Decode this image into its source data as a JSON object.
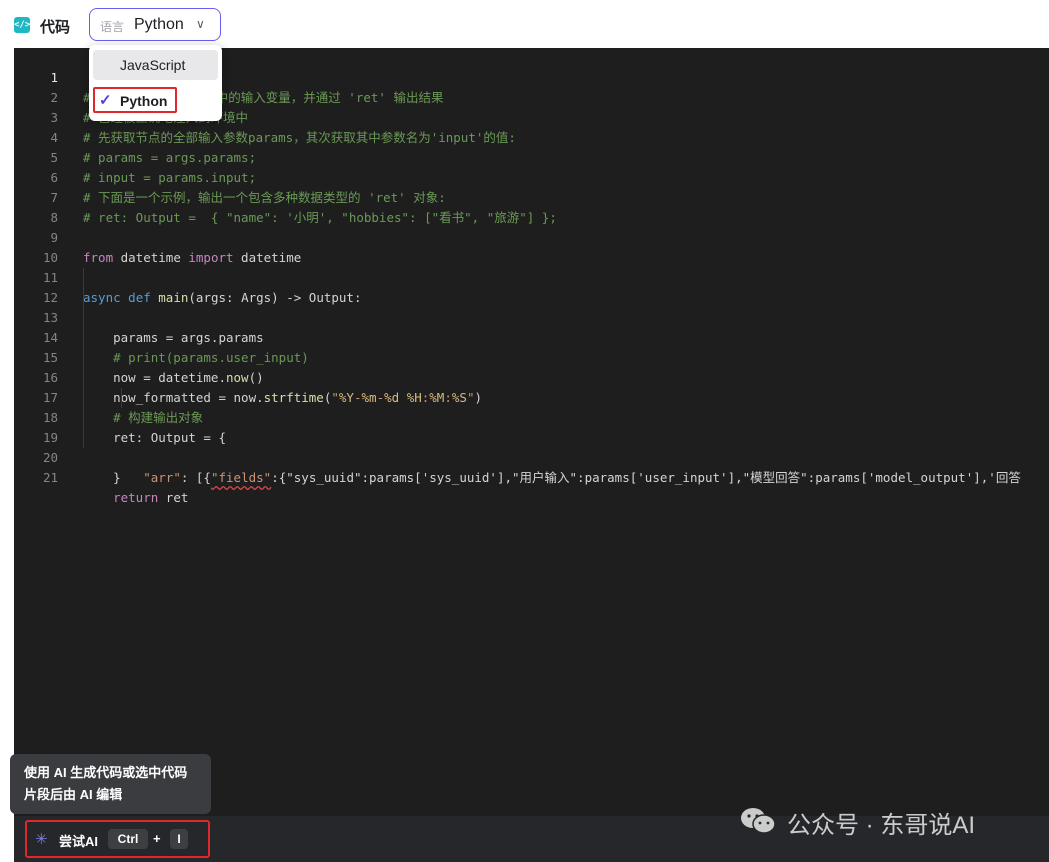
{
  "header": {
    "icon": "code-icon",
    "title": "代码",
    "language_prefix": "语言",
    "language_value": "Python"
  },
  "dropdown": {
    "options": [
      {
        "label": "JavaScript",
        "state": "hover"
      },
      {
        "label": "Python",
        "state": "selected"
      }
    ]
  },
  "editor": {
    "active_line": 1,
    "lines": [
      {
        "n": "1",
        "visible_text": "# 'args'   获取节点中的输入变量，并通过 'ret' 输出结果"
      },
      {
        "n": "2",
        "visible_text": "# 已经被正确地注入到环境中"
      },
      {
        "n": "3",
        "visible_text": "# 先获取节点的全部输入参数params，其次获取其中参数名为'input'的值:"
      },
      {
        "n": "4",
        "visible_text": "# params = args.params;"
      },
      {
        "n": "5",
        "visible_text": "# input = params.input;"
      },
      {
        "n": "6",
        "visible_text": "# 下面是一个示例，输出一个包含多种数据类型的 'ret' 对象:"
      },
      {
        "n": "7",
        "visible_text": "# ret: Output =  { \"name\": '小明', \"hobbies\": [\"看书\", \"旅游\"] };"
      },
      {
        "n": "8",
        "visible_text": ""
      },
      {
        "n": "9",
        "visible_text": "from datetime import datetime"
      },
      {
        "n": "10",
        "visible_text": ""
      },
      {
        "n": "11",
        "visible_text": "async def main(args: Args) -> Output:"
      },
      {
        "n": "12",
        "visible_text": "    params = args.params"
      },
      {
        "n": "13",
        "visible_text": "    # print(params.user_input)"
      },
      {
        "n": "14",
        "visible_text": "    now = datetime.now()"
      },
      {
        "n": "15",
        "visible_text": "    now_formatted = now.strftime(\"%Y-%m-%d %H:%M:%S\")"
      },
      {
        "n": "16",
        "visible_text": "    # 构建输出对象"
      },
      {
        "n": "17",
        "visible_text": "    ret: Output = {"
      },
      {
        "n": "18",
        "visible_text": "        \"arr\": [{\"fields\":{\"sys_uuid\":params['sys_uuid'],\"用户输入\":params['user_input'],\"模型回答\":params['model_output'],'回答"
      },
      {
        "n": "19",
        "visible_text": "    }"
      },
      {
        "n": "20",
        "visible_text": "    return ret"
      },
      {
        "n": "21",
        "visible_text": ""
      }
    ]
  },
  "tooltip": {
    "line1": "使用 AI 生成代码或选中代码",
    "line2": "片段后由 AI 编辑"
  },
  "bottom_bar": {
    "try_ai_icon": "sparkle-loading-icon",
    "try_ai_label": "尝试AI",
    "shortcut_key1": "Ctrl",
    "shortcut_plus": "+",
    "shortcut_key2": "I"
  },
  "watermark": {
    "icon": "wechat-icon",
    "text": "公众号 · 东哥说AI"
  },
  "colors": {
    "accent": "#6b5cf6",
    "check": "#4e40e5",
    "highlight_box": "#e0282c",
    "editor_bg": "#1e1e1e"
  }
}
